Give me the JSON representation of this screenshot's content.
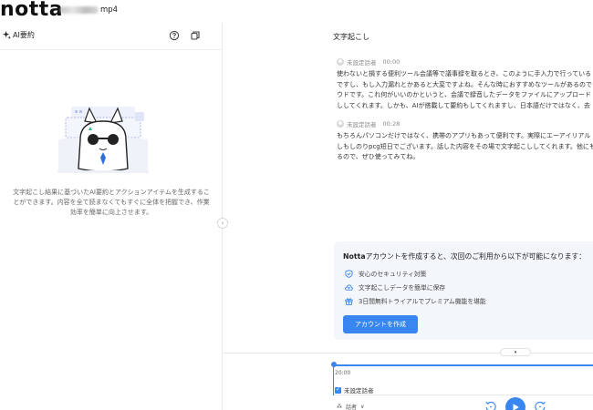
{
  "app": {
    "logo": "notta",
    "file_ext": "mp4"
  },
  "left": {
    "title": "AI要約",
    "description": "文字起こし結果に基づいたAI要約とアクションアイテムを生成することができます。内容を全て読まなくてもすぐに全体を把握でき、作業効率を簡単に向上させます。",
    "collapse_glyph": "‹"
  },
  "right": {
    "title": "文字起こし",
    "segments": [
      {
        "speaker": "未設定話者",
        "time": "00:00",
        "lines": [
          "使わないと損する便利ツール会議等で議事録を取るとき、このように手入力で行っている",
          "ですし、もし入力漏れとかあると大変ですよね。そんな時におすすめなツールがあるので",
          "ウドです。これ何がいいのかというと、会議で録音したデータをファイルにアップロード",
          "ししてくれます。しかも、AIが搭載して要約もしてくれますし、日本語だけではなく、去"
        ]
      },
      {
        "speaker": "未設定話者",
        "time": "00:28",
        "lines": [
          "もちろんパソコンだけではなく、携帯のアプリもあって便利です。実際にエーアイリアル",
          "しもしのりpcg短日でございます。話した内容をその場で文字起こししてくれます。他にも",
          "るので、ぜひ使ってみてね。"
        ]
      }
    ],
    "promo": {
      "title_brand": "Notta",
      "title_rest": "アカウントを作成すると、次回のご利用から以下が可能になります：",
      "items": [
        "安心のセキュリティ対策",
        "文字起こしデータを簡単に保存",
        "3日間無料トライアルでプレミアム機能を堪能"
      ],
      "button": "アカウントを作成"
    },
    "player": {
      "chevron": "▾",
      "time_label": "20:00",
      "speaker_filter": "未設定話者",
      "chk_mark": "✓",
      "speaker_icon": "⁂",
      "speaker_name": "話者",
      "dropdown_glyph": "∨"
    }
  }
}
